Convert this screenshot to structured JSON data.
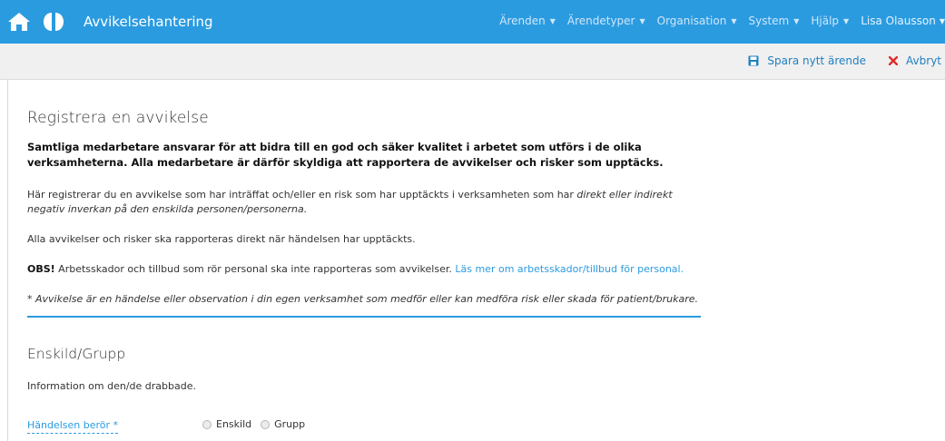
{
  "navbar": {
    "title": "Avvikelsehantering",
    "menu": [
      {
        "label": "Ärenden"
      },
      {
        "label": "Ärendetyper"
      },
      {
        "label": "Organisation"
      },
      {
        "label": "System"
      },
      {
        "label": "Hjälp"
      }
    ],
    "user": "Lisa Olausson",
    "icons": {
      "home": "home-icon",
      "logo": "brand-logo-icon",
      "caret": "caret-down-icon"
    }
  },
  "actions": {
    "save_label": "Spara nytt ärende",
    "cancel_label": "Avbryt",
    "save_icon": "save-icon",
    "cancel_icon": "close-icon"
  },
  "form": {
    "title": "Registrera en avvikelse",
    "lead": "Samtliga medarbetare ansvarar för att bidra till en god och säker kvalitet i arbetet som utförs i de olika verksamheterna. Alla medarbetare är därför skyldiga att rapportera de avvikelser och risker som upptäcks.",
    "p1_plain": "Här registrerar du en avvikelse som har inträffat och/eller en risk som har upptäckts i verksamheten som har ",
    "p1_italic": "direkt eller indirekt negativ inverkan på den enskilda personen/personerna.",
    "p2": "Alla avvikelser och risker ska rapporteras direkt när händelsen har upptäckts.",
    "p3_bold": "OBS!",
    "p3_text": " Arbetsskador och tillbud som rör personal ska inte rapporteras som avvikelser. ",
    "p3_link": "Läs mer om arbetsskador/tillbud för personal.",
    "p4": "* Avvikelse är en händelse eller observation i din egen verksamhet som medför eller kan medföra risk eller skada för patient/brukare."
  },
  "section": {
    "title": "Enskild/Grupp",
    "description": "Information om den/de drabbade.",
    "field_label": "Händelsen berör *",
    "options": [
      {
        "label": "Enskild",
        "checked": false
      },
      {
        "label": "Grupp",
        "checked": false
      }
    ]
  },
  "colors": {
    "primary": "#2b9be0",
    "cancel": "#e02c2c",
    "actionbar_bg": "#f0f0f0"
  }
}
